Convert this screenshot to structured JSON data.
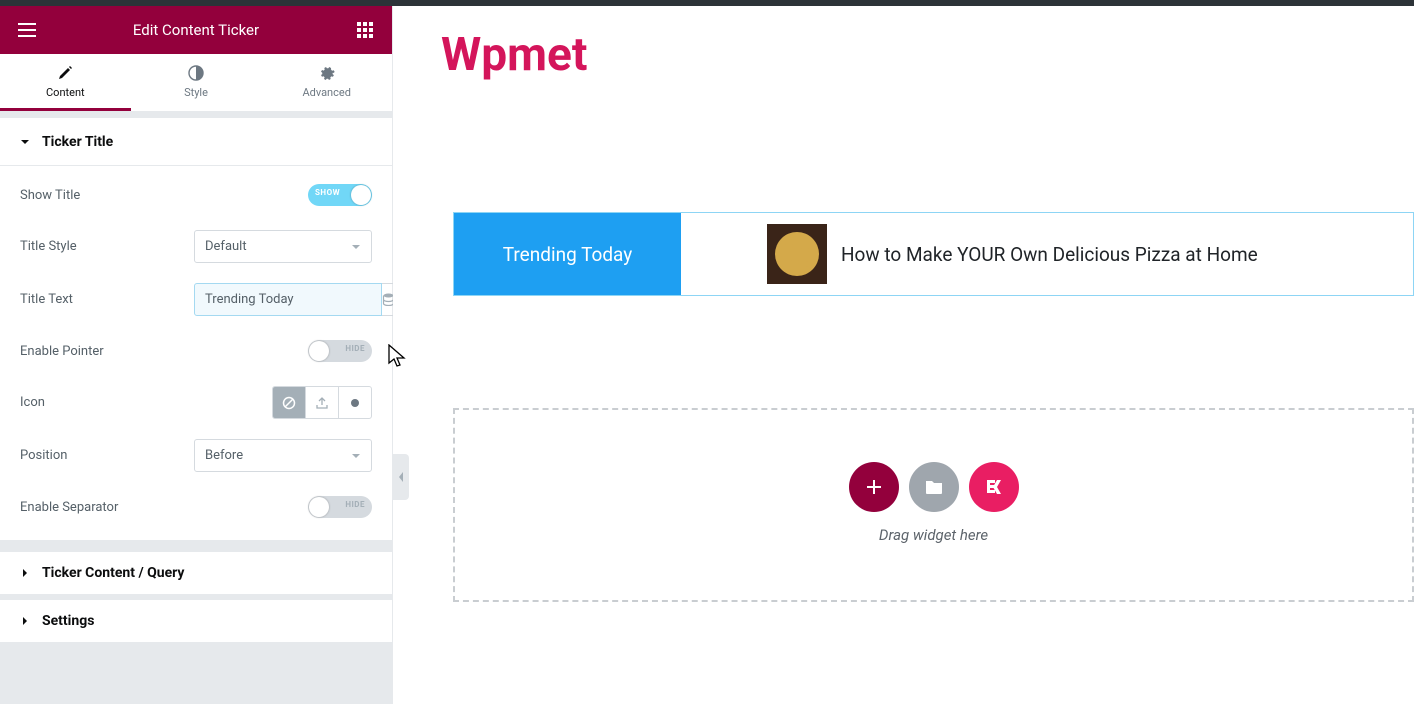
{
  "header": {
    "title": "Edit Content Ticker"
  },
  "tabs": {
    "content": "Content",
    "style": "Style",
    "advanced": "Advanced"
  },
  "sections": {
    "ticker_title": "Ticker Title",
    "ticker_content": "Ticker Content / Query",
    "settings": "Settings"
  },
  "fields": {
    "show_title": {
      "label": "Show Title",
      "state": "SHOW"
    },
    "title_style": {
      "label": "Title Style",
      "value": "Default"
    },
    "title_text": {
      "label": "Title Text",
      "value": "Trending Today"
    },
    "enable_pointer": {
      "label": "Enable Pointer",
      "state": "HIDE"
    },
    "icon": {
      "label": "Icon"
    },
    "position": {
      "label": "Position",
      "value": "Before"
    },
    "enable_separator": {
      "label": "Enable Separator",
      "state": "HIDE"
    }
  },
  "preview": {
    "brand": "Wpmet",
    "ticker_title": "Trending Today",
    "ticker_item": "How to Make YOUR Own Delicious Pizza at Home",
    "dropzone_hint": "Drag widget here"
  }
}
